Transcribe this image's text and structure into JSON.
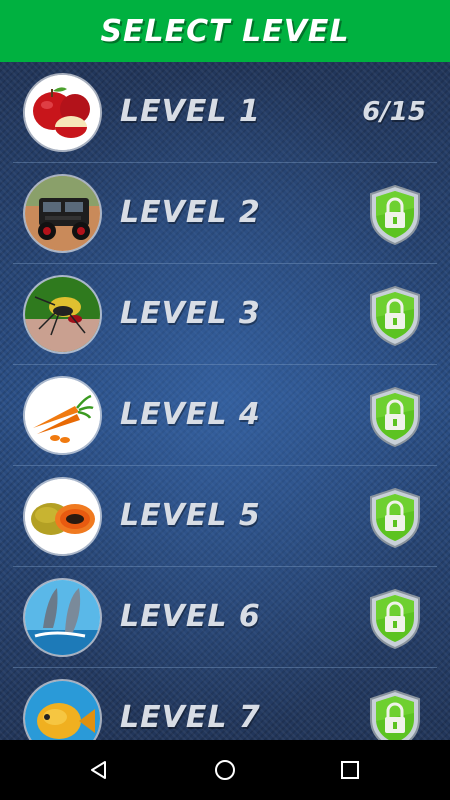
{
  "header": {
    "title": "SELECT LEVEL",
    "color": "#00b140"
  },
  "levels": [
    {
      "label": "LEVEL 1",
      "locked": false,
      "progress": "6/15",
      "image": "apple"
    },
    {
      "label": "LEVEL 2",
      "locked": true,
      "image": "jeep"
    },
    {
      "label": "LEVEL 3",
      "locked": true,
      "image": "mosquito"
    },
    {
      "label": "LEVEL 4",
      "locked": true,
      "image": "carrot"
    },
    {
      "label": "LEVEL 5",
      "locked": true,
      "image": "papaya"
    },
    {
      "label": "LEVEL 6",
      "locked": true,
      "image": "dolphin"
    },
    {
      "label": "LEVEL 7",
      "locked": true,
      "image": "fish"
    }
  ],
  "icons": {
    "lock": "lock-shield-icon",
    "back": "back-icon",
    "home": "home-icon",
    "recents": "recents-icon"
  },
  "colors": {
    "lock_green": "#5cc321",
    "text": "#d8dde5"
  }
}
